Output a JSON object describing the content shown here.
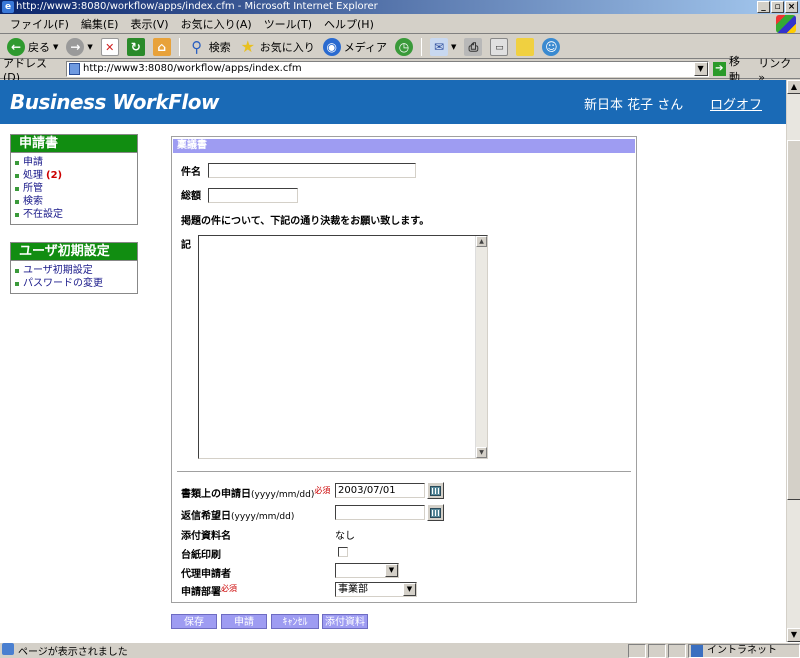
{
  "window": {
    "title": "http://www3:8080/workflow/apps/index.cfm - Microsoft Internet Explorer",
    "ie_glyph": "e"
  },
  "menu": {
    "items": [
      "ファイル(F)",
      "編集(E)",
      "表示(V)",
      "お気に入り(A)",
      "ツール(T)",
      "ヘルプ(H)"
    ]
  },
  "toolbar": {
    "back_label": "戻る",
    "search_label": "検索",
    "favorites_label": "お気に入り",
    "media_label": "メディア"
  },
  "address": {
    "label": "アドレス(D)",
    "url": "http://www3:8080/workflow/apps/index.cfm",
    "go_label": "移動",
    "links_label": "リンク »"
  },
  "header": {
    "logo": "Business WorkFlow",
    "user": "新日本 花子 さん",
    "logout": "ログオフ"
  },
  "nav": {
    "application": {
      "title": "申請書",
      "items": [
        "申請",
        "処理",
        "所管",
        "検索",
        "不在設定"
      ],
      "pending_count": "(2)"
    },
    "user_settings": {
      "title": "ユーザ初期設定",
      "items": [
        "ユーザ初期設定",
        "パスワードの変更"
      ]
    }
  },
  "form": {
    "panel_title": "稟議書",
    "subject_label": "件名",
    "amount_label": "総額",
    "intro_text": "掲題の件について、下記の通り決裁をお願い致します。",
    "note_label": "記",
    "apply_date_label": "書類上の申請日",
    "date_format": "(yyyy/mm/dd)",
    "required_mark": "必須",
    "apply_date_value": "2003/07/01",
    "reply_date_label": "返信希望日",
    "reply_date_value": "",
    "attachment_label": "添付資料名",
    "attachment_value": "なし",
    "ledger_print_label": "台紙印刷",
    "proxy_label": "代理申請者",
    "proxy_value": "",
    "department_label": "申請部署",
    "department_value": "事業部"
  },
  "buttons": {
    "save": "保存",
    "apply": "申請",
    "cancel": "ｷｬﾝｾﾙ",
    "attach": "添付資料"
  },
  "status": {
    "text": "ページが表示されました",
    "zone": "イントラネット"
  },
  "colors": {
    "header_blue": "#1a6ab6",
    "nav_green": "#118d11",
    "button_lavender": "#9e9cf2",
    "required_red": "#c00000"
  }
}
